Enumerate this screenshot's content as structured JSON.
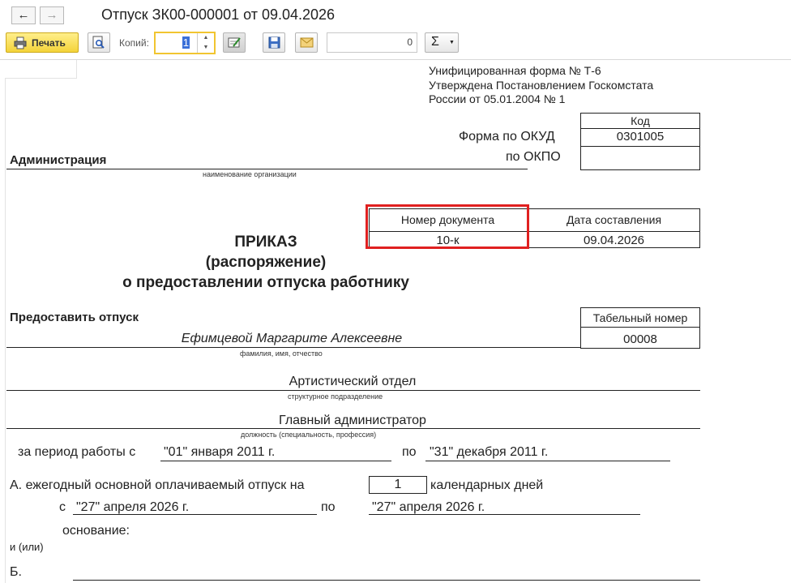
{
  "window": {
    "title": "Отпуск ЗК00-000001 от 09.04.2026",
    "back_icon": "arrow-left-icon",
    "forward_icon": "arrow-right-icon"
  },
  "toolbar": {
    "print_label": "Печать",
    "copies_label": "Копий:",
    "copies_value": "1",
    "number_value": "0",
    "sum_label": "Σ",
    "sum_dropdown_icon": "chevron-down-icon",
    "icons": [
      "printer-icon",
      "preview-icon",
      "edit-icon",
      "save-icon",
      "email-icon"
    ]
  },
  "doc": {
    "form_note": [
      "Унифицированная форма № Т-6",
      "Утверждена Постановлением Госкомстата",
      "России от 05.01.2004 № 1"
    ],
    "code_header": "Код",
    "okud_label": "Форма по ОКУД",
    "okud_value": "0301005",
    "okpo_label": "по ОКПО",
    "okpo_value": "",
    "organization": "Администрация",
    "organization_caption": "наименование организации",
    "doc_number_header": "Номер документа",
    "doc_date_header": "Дата составления",
    "doc_number": "10-к",
    "doc_date": "09.04.2026",
    "order_title": [
      "ПРИКАЗ",
      "(распоряжение)",
      "о предоставлении отпуска работнику"
    ],
    "grant_leave": "Предоставить отпуск",
    "tab_number_header": "Табельный номер",
    "tab_number": "00008",
    "employee_name": "Ефимцевой Маргарите Алексеевне",
    "employee_caption": "фамилия, имя, отчество",
    "department": "Артистический отдел",
    "department_caption": "структурное подразделение",
    "position": "Главный администратор",
    "position_caption": "должность (специальность, профессия)",
    "period_label": "за период работы с",
    "period_from": "\"01\" января 2011 г.",
    "period_to_label": "по",
    "period_to": "\"31\" декабря 2011 г.",
    "annual_label": "А. ежегодный основной оплачиваемый отпуск на",
    "annual_days": "1",
    "annual_days_unit": "календарных дней",
    "from_label": "с",
    "leave_from": "\"27\" апреля 2026 г.",
    "to_label": "по",
    "leave_to": "\"27\" апреля 2026 г.",
    "basis_label": "основание:",
    "and_or": "и (или)",
    "b_label": "Б.",
    "highlight_color": "#e02020"
  }
}
